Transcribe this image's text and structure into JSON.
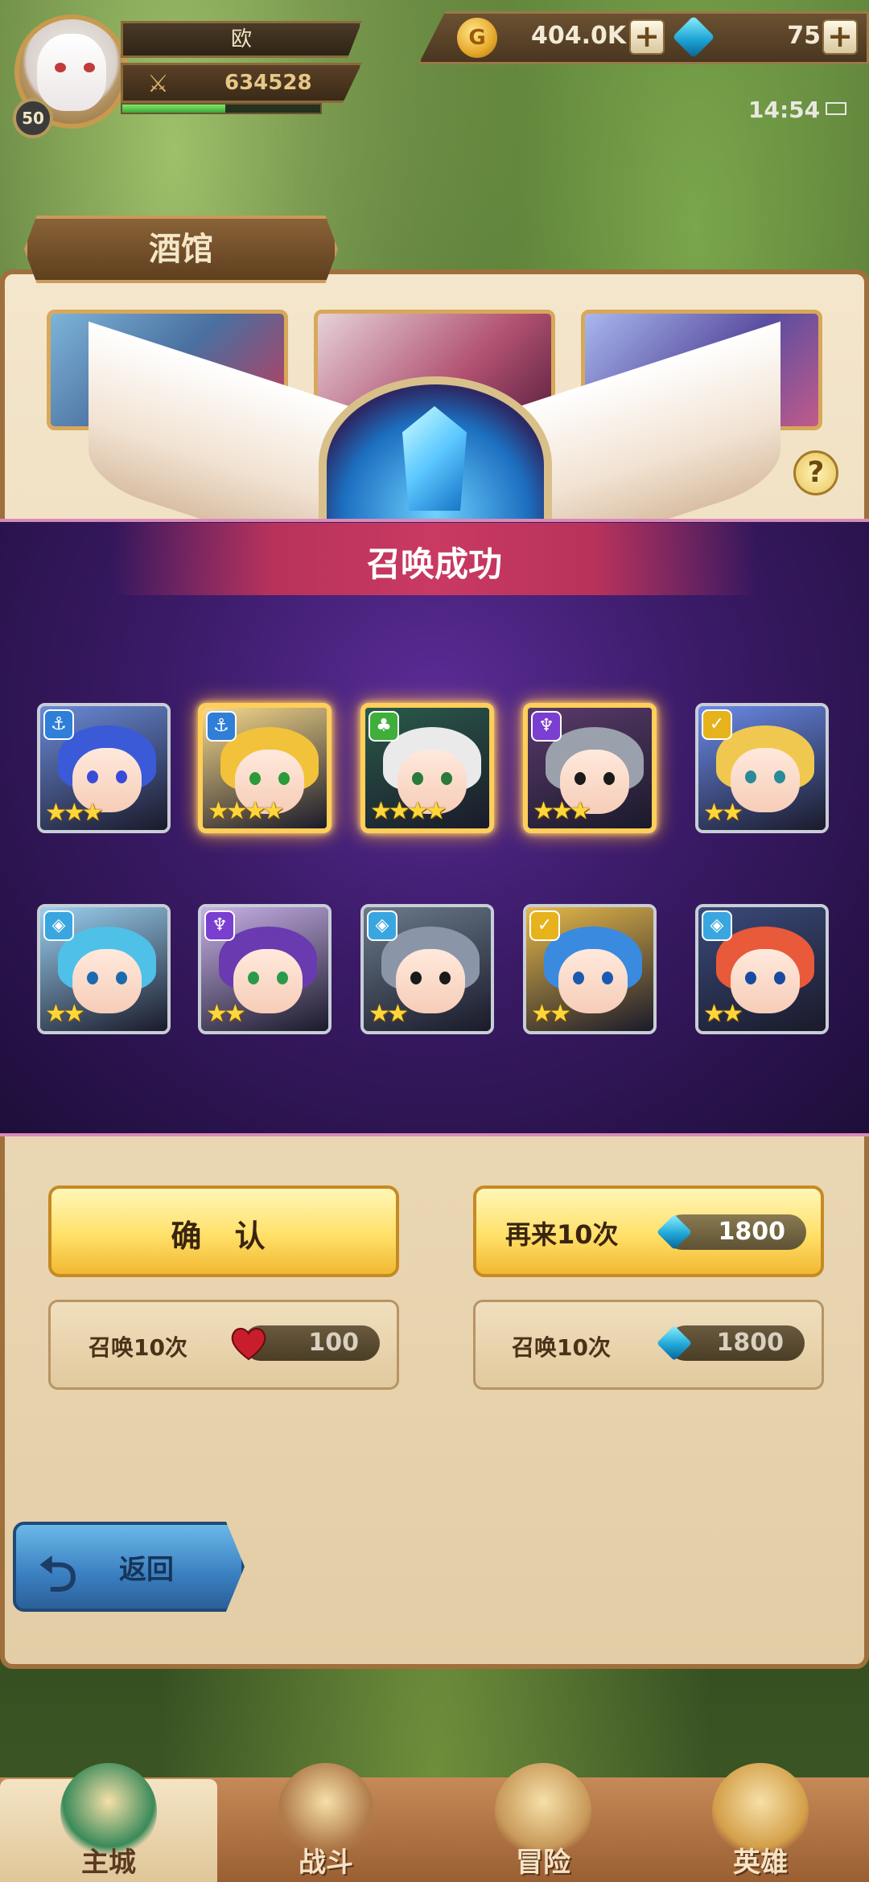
{
  "player": {
    "name": "欧",
    "level": "50",
    "power": "634528",
    "xp_fraction": 0.52
  },
  "resources": {
    "gold": "404.0K",
    "gold_symbol": "G",
    "gems": "75",
    "plus_symbol": "+"
  },
  "status_bar": {
    "time": "14:54"
  },
  "tavern": {
    "title": "酒馆",
    "help_symbol": "?"
  },
  "summon_result": {
    "title": "召唤成功",
    "heroes_row1": [
      {
        "faction": "anchor",
        "faction_glyph": "⚓",
        "stars": "★★★",
        "star_count": 3,
        "highlight": false
      },
      {
        "faction": "anchor",
        "faction_glyph": "⚓",
        "stars": "★★★★",
        "star_count": 4,
        "highlight": true
      },
      {
        "faction": "nature",
        "faction_glyph": "♣",
        "stars": "★★★★",
        "star_count": 4,
        "highlight": true
      },
      {
        "faction": "demon",
        "faction_glyph": "♆",
        "stars": "★★★",
        "star_count": 3,
        "highlight": true
      },
      {
        "faction": "light",
        "faction_glyph": "✓",
        "stars": "★★",
        "star_count": 2,
        "highlight": false
      }
    ],
    "heroes_row2": [
      {
        "faction": "water",
        "faction_glyph": "◈",
        "stars": "★★",
        "star_count": 2
      },
      {
        "faction": "demon",
        "faction_glyph": "♆",
        "stars": "★★",
        "star_count": 2
      },
      {
        "faction": "water",
        "faction_glyph": "◈",
        "stars": "★★",
        "star_count": 2
      },
      {
        "faction": "light",
        "faction_glyph": "✓",
        "stars": "★★",
        "star_count": 2
      },
      {
        "faction": "water",
        "faction_glyph": "◈",
        "stars": "★★",
        "star_count": 2
      }
    ]
  },
  "actions": {
    "confirm_label": "确 认",
    "again_label": "再来10次",
    "again_cost": "1800",
    "summon_friend_label": "召唤10次",
    "summon_friend_cost": "100",
    "summon_gem_label": "召唤10次",
    "summon_gem_cost": "1800",
    "back_label": "返回",
    "back_arrow": "⮌"
  },
  "nav": {
    "items": [
      {
        "label": "主城",
        "active": true
      },
      {
        "label": "战斗",
        "active": false
      },
      {
        "label": "冒险",
        "active": false
      },
      {
        "label": "英雄",
        "active": false
      }
    ]
  },
  "colors": {
    "anchor": "#2f7fd9",
    "nature": "#3fae3a",
    "demon": "#7a3ed0",
    "light": "#e6b31c",
    "water": "#3aa6e0"
  }
}
